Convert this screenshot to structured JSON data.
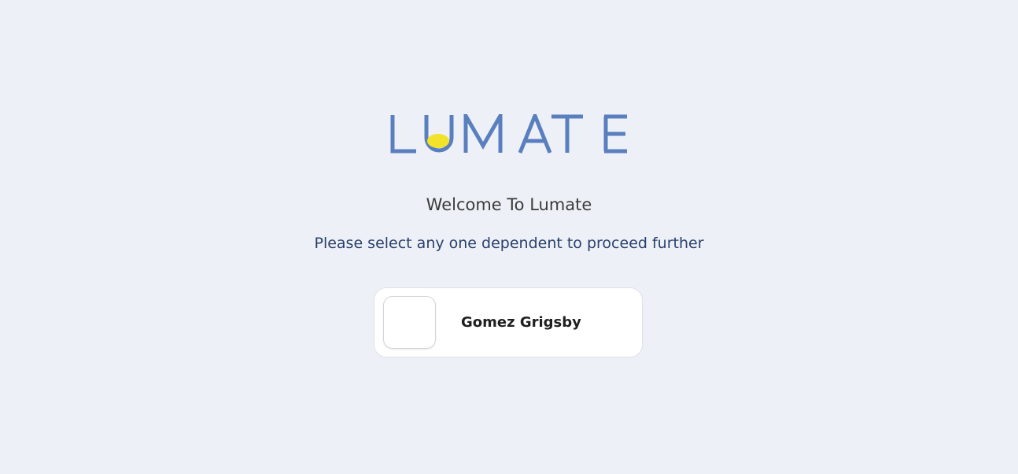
{
  "brand": {
    "name": "LUMATE",
    "primary_color": "#5a7fbf",
    "accent_color": "#f2e32a"
  },
  "welcome_text": "Welcome To Lumate",
  "instruction_text": "Please select any one dependent to proceed further",
  "dependents": [
    {
      "name": "Gomez Grigsby",
      "avatar": "avatar-placeholder"
    }
  ]
}
